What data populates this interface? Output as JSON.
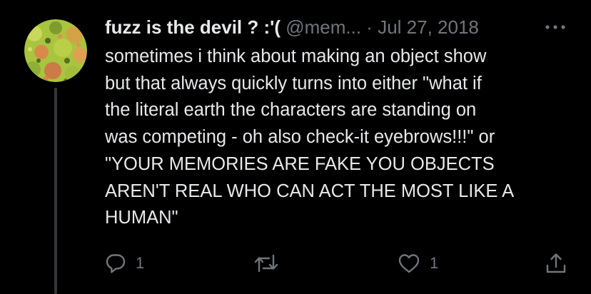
{
  "user": {
    "display_name": "fuzz is the devil ? :'(",
    "handle": "@mem...",
    "separator": "·",
    "timestamp": "Jul 27, 2018"
  },
  "tweet": {
    "lines": [
      "sometimes i think about making an object show",
      "but that always quickly turns into either \"what if",
      "the literal earth the characters are standing on",
      "was competing - oh also check-it eyebrows!!!\" or",
      "\"YOUR MEMORIES ARE FAKE YOU OBJECTS",
      "AREN'T REAL WHO CAN ACT THE MOST LIKE A",
      "HUMAN\""
    ]
  },
  "actions": {
    "reply_count": "1",
    "retweet_count": "",
    "like_count": "1"
  },
  "icons": {
    "more": "more-horizontal-icon",
    "reply": "reply-icon",
    "retweet": "retweet-icon",
    "like": "heart-icon",
    "share": "share-icon"
  },
  "colors": {
    "background": "#000000",
    "text": "#e7e9ea",
    "secondary": "#71767b",
    "thread_line": "#333639"
  }
}
